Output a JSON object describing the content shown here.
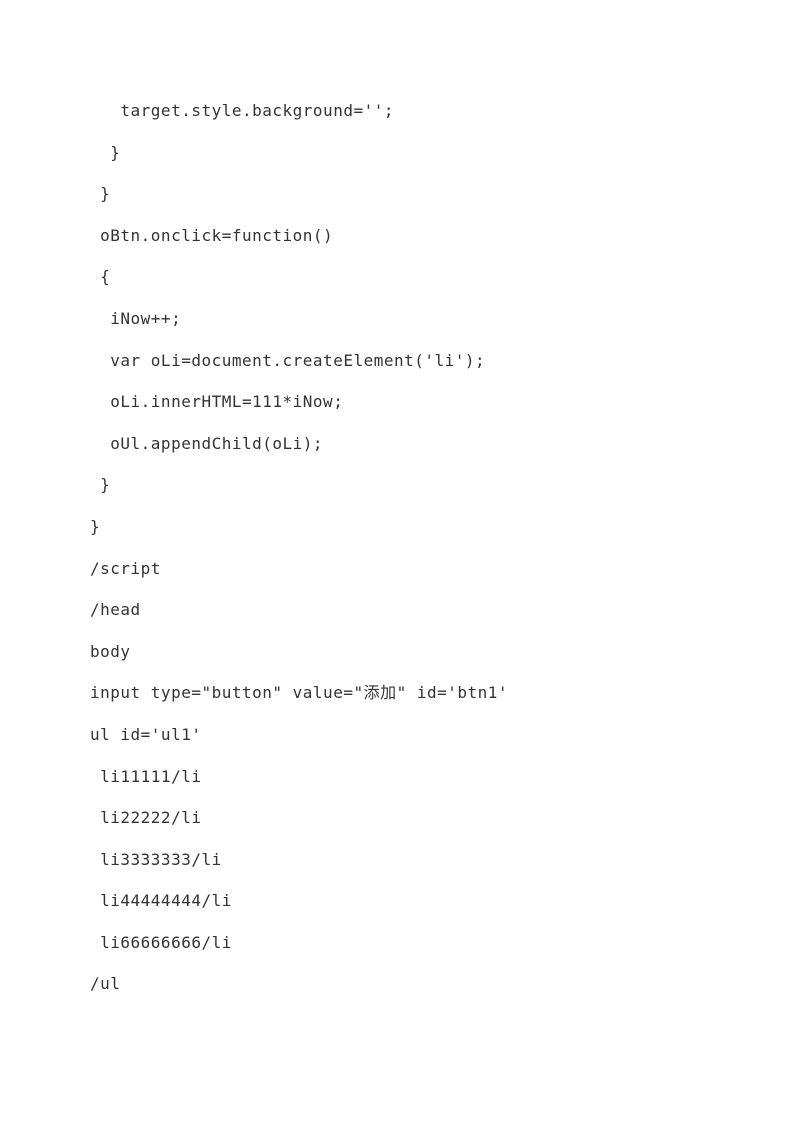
{
  "lines": [
    "   target.style.background='';",
    "  }",
    " }",
    " oBtn.onclick=function()",
    " {",
    "  iNow++;",
    "  var oLi=document.createElement('li');",
    "  oLi.innerHTML=111*iNow;",
    "  oUl.appendChild(oLi);",
    " }",
    "}",
    "/script",
    "/head",
    "body",
    "input type=\"button\" value=\"添加\" id='btn1'",
    "ul id='ul1'",
    " li11111/li",
    " li22222/li",
    " li3333333/li",
    " li44444444/li",
    " li66666666/li",
    "/ul"
  ]
}
